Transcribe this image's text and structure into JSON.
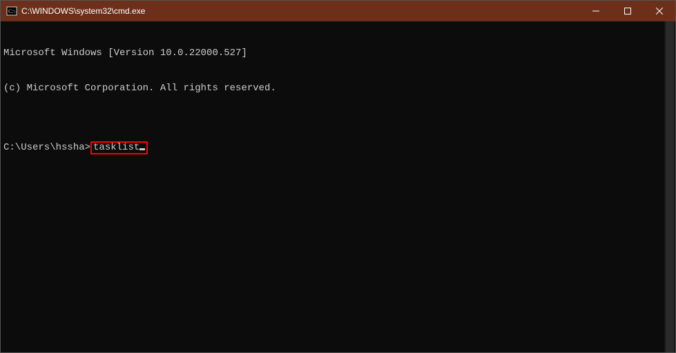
{
  "titlebar": {
    "title": "C:\\WINDOWS\\system32\\cmd.exe"
  },
  "terminal": {
    "line1": "Microsoft Windows [Version 10.0.22000.527]",
    "line2": "(c) Microsoft Corporation. All rights reserved.",
    "blank": "",
    "prompt": "C:\\Users\\hssha>",
    "command": "tasklist"
  },
  "highlight_color": "#ff0000"
}
